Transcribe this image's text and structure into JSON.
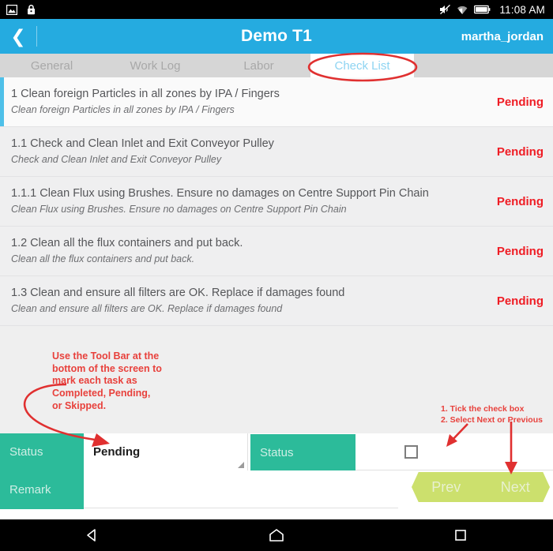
{
  "statusbar": {
    "icons_left": [
      "image-icon",
      "lock-icon"
    ],
    "icons_right": [
      "mute-icon",
      "wifi-icon",
      "battery-icon"
    ],
    "clock": "11:08 AM"
  },
  "appbar": {
    "back_icon": "back-chevron-icon",
    "back_glyph": "❮",
    "title": "Demo T1",
    "user": "martha_jordan",
    "bg_color": "#25abe0"
  },
  "tabs": [
    {
      "label": "General",
      "active": false
    },
    {
      "label": "Work Log",
      "active": false
    },
    {
      "label": "Labor",
      "active": false
    },
    {
      "label": "Check List",
      "active": true
    }
  ],
  "checklist": {
    "status_color": "#ef1c24",
    "rows": [
      {
        "title": "1 Clean foreign Particles in all zones by IPA / Fingers",
        "subtitle": "Clean foreign Particles in all zones by IPA / Fingers",
        "status": "Pending",
        "selected": true
      },
      {
        "title": "1.1 Check and Clean Inlet and Exit Conveyor Pulley",
        "subtitle": "Check and Clean Inlet and Exit Conveyor Pulley",
        "status": "Pending",
        "selected": false
      },
      {
        "title": "1.1.1 Clean Flux using Brushes. Ensure no damages on Centre Support Pin Chain",
        "subtitle": "Clean Flux using Brushes. Ensure no damages on Centre Support Pin Chain",
        "status": "Pending",
        "selected": false
      },
      {
        "title": "1.2 Clean all the flux containers and put back.",
        "subtitle": "Clean all the flux containers and put back.",
        "status": "Pending",
        "selected": false
      },
      {
        "title": "1.3 Clean and ensure all filters are OK. Replace if damages found",
        "subtitle": "Clean and ensure all filters are OK. Replace if damages found",
        "status": "Pending",
        "selected": false
      }
    ]
  },
  "annotations": {
    "color": "#e8413c",
    "toolbar_note": "Use the Tool Bar at the bottom of the screen to mark each task as Completed, Pending, or Skipped.",
    "step_1": "1. Tick the check box",
    "step_2": "2. Select Next or Previous"
  },
  "toolbar": {
    "status_label": "Status",
    "remark_label": "Remark",
    "status_value": "Pending",
    "status2_label": "Status",
    "remark_value": "",
    "remark_placeholder": "",
    "checkbox_checked": false,
    "prev_label": "Prev",
    "next_label": "Next",
    "teal_color": "#2cbb9a",
    "nav_button_color": "#cce06d"
  },
  "navbar": {
    "back": "back-triangle-icon",
    "home": "home-icon",
    "recents": "recents-square-icon"
  }
}
